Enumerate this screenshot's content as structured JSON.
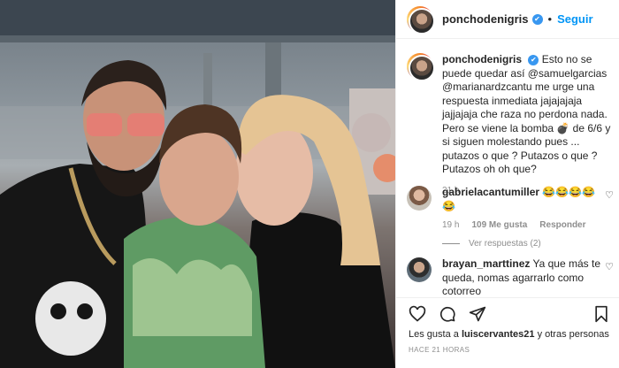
{
  "post": {
    "username": "ponchodenigris",
    "verified_symbol": "✔",
    "separator": "•",
    "follow_label": "Seguir"
  },
  "caption": {
    "username": "ponchodenigris",
    "text": "Esto no se puede quedar así @samuelgarcias @marianardzcantu me urge una respuesta inmediata jajajajaja jajjajaja che raza no perdona nada. Pero se viene la bomba 💣 de 6/6 y si siguen molestando pues ... putazos o que ? Putazos o que ? Putazos oh oh que?",
    "age": "21 h"
  },
  "comments": [
    {
      "username": "gabrielacantumiller",
      "text": "😂😂😂😂😂",
      "age": "19 h",
      "likes": "109 Me gusta",
      "reply_label": "Responder",
      "view_replies": "Ver respuestas (2)"
    },
    {
      "username": "brayan_marttinez",
      "text": "Ya que más te queda, nomas agarrarlo como cotorreo"
    }
  ],
  "footer": {
    "likes_prefix": "Les gusta a",
    "likes_user": "luiscervantes21",
    "likes_suffix": "y otras personas",
    "timestamp": "HACE 21 HORAS"
  },
  "icons": {
    "like": "heart-icon",
    "comment": "comment-icon",
    "share": "share-icon",
    "save": "bookmark-icon"
  },
  "colors": {
    "accent": "#0095f6",
    "verified": "#3897f0",
    "muted": "#8e8e8e"
  }
}
